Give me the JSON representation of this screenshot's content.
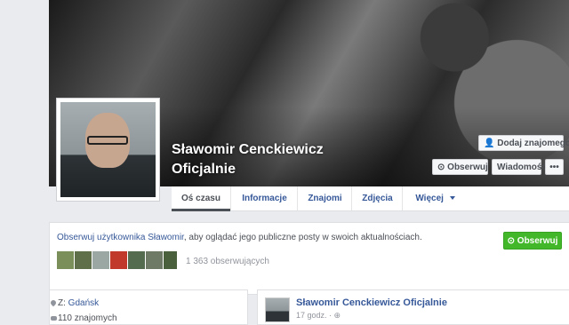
{
  "page": {
    "name_line1": "Sławomir Cenckiewicz",
    "name_line2": "Oficjalnie"
  },
  "cover_buttons": {
    "add_friend": "Dodaj znajomego",
    "follow": "Obserwuj",
    "message": "Wiadomość",
    "more": "•••"
  },
  "tabs": [
    {
      "label": "Oś czasu",
      "active": true
    },
    {
      "label": "Informacje"
    },
    {
      "label": "Znajomi"
    },
    {
      "label": "Zdjęcia"
    },
    {
      "label": "Więcej"
    }
  ],
  "follow_box": {
    "link_text": "Obserwuj użytkownika Sławomir",
    "rest_text": ", aby oglądać jego publiczne posty w swoich aktualnościach.",
    "button": "Obserwuj",
    "followers": "1 363 obserwujących"
  },
  "intro": {
    "location_prefix": "Z: ",
    "location": "Gdańsk",
    "friends": "110 znajomych"
  },
  "post": {
    "author": "Sławomir Cenckiewicz Oficjalnie",
    "time": "17 godz. · "
  },
  "colors": {
    "link": "#365899",
    "green_button": "#42b72a",
    "background": "#e9ebee"
  }
}
